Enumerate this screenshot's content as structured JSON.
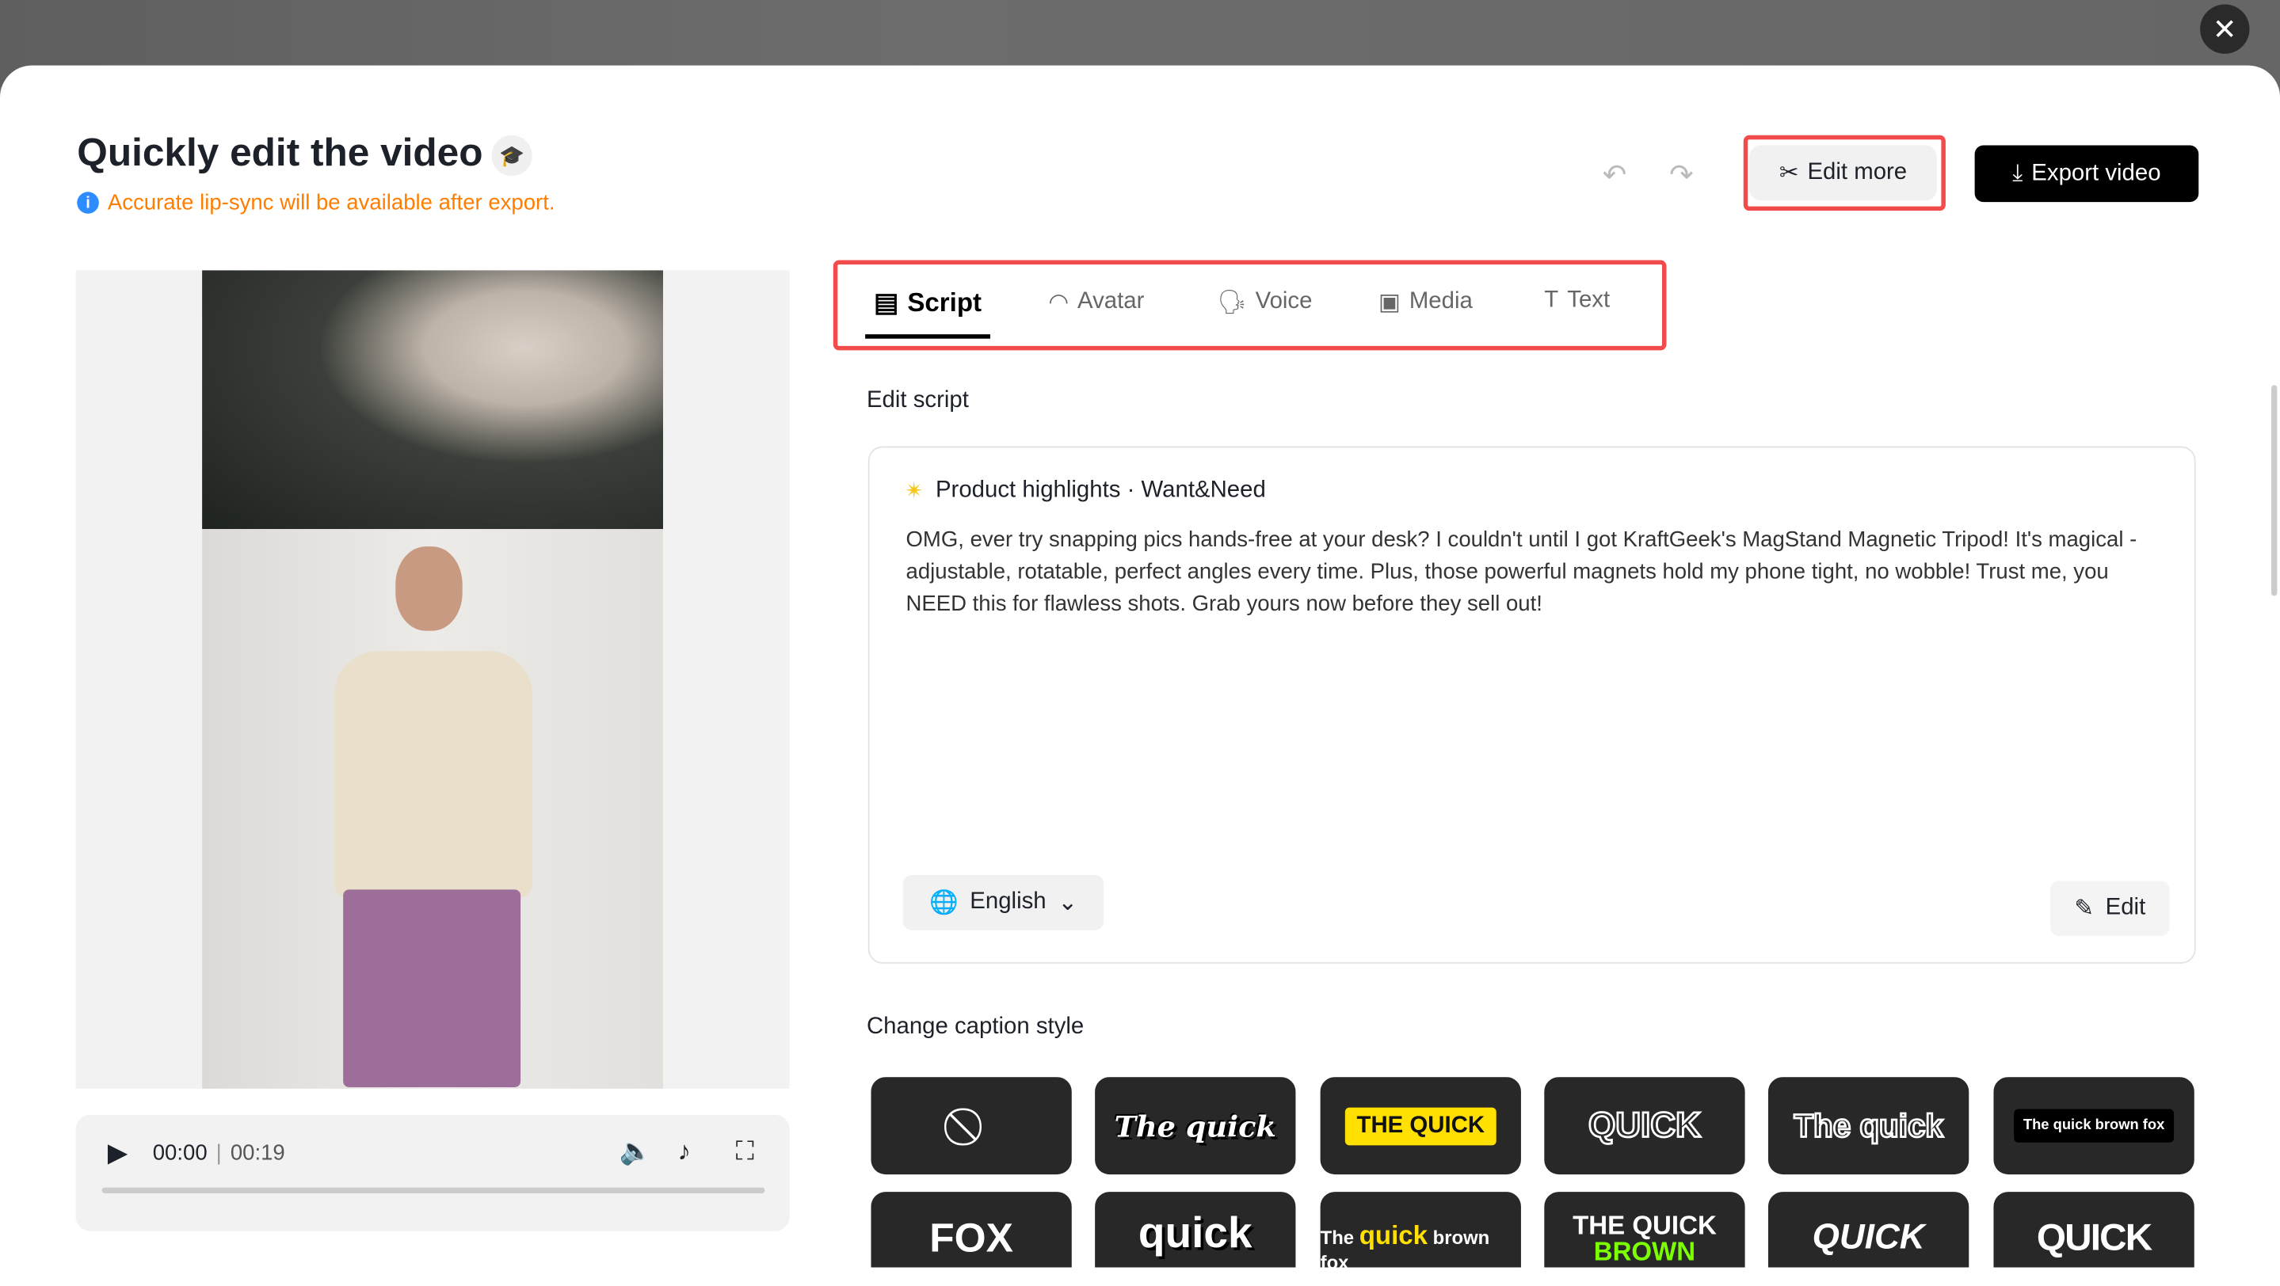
{
  "header": {
    "title": "Quickly edit the video",
    "notice": "Accurate lip-sync will be available after export.",
    "edit_more": "Edit more",
    "export": "Export video"
  },
  "player": {
    "current": "00:00",
    "separator": "|",
    "duration": "00:19",
    "progress": 0
  },
  "tabs": [
    {
      "label": "Script",
      "icon": "script-icon"
    },
    {
      "label": "Avatar",
      "icon": "avatar-icon"
    },
    {
      "label": "Voice",
      "icon": "voice-icon"
    },
    {
      "label": "Media",
      "icon": "media-icon"
    },
    {
      "label": "Text",
      "icon": "text-icon"
    }
  ],
  "script": {
    "section_label": "Edit script",
    "heading": "Product highlights · Want&Need",
    "body": "OMG, ever try snapping pics hands-free at your desk? I couldn't until I got KraftGeek's MagStand Magnetic Tripod! It's magical - adjustable, rotatable, perfect angles every time. Plus, those powerful magnets hold my phone tight, no wobble! Trust me, you NEED this for flawless shots. Grab yours now before they sell out!",
    "language": "English",
    "edit": "Edit"
  },
  "captions": {
    "label": "Change caption style",
    "styles": [
      "The quick",
      "THE QUICK",
      "QUICK",
      "The quick",
      "The quick brown fox",
      "FOX",
      "quick",
      "The quick brown fox",
      "THE QUICK BROWN FOX",
      "QUICK",
      "QUICK"
    ],
    "highlight_word": "quick"
  },
  "colors": {
    "accent_red": "#f24b4b",
    "notice": "#ff7d00",
    "caption_yellow": "#ffe000",
    "caption_green": "#7cff00"
  }
}
